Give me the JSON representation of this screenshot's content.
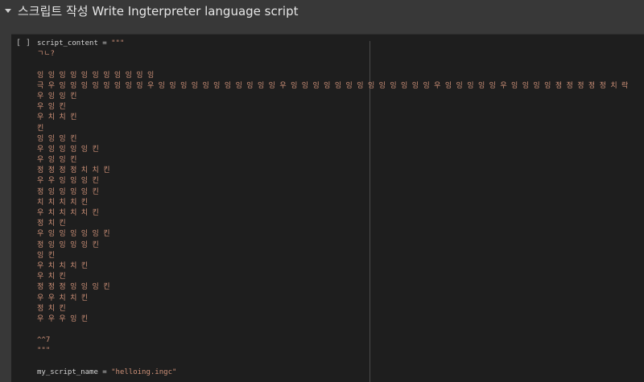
{
  "header": {
    "title": "스크립트 작성 Write Ingterpreter language script"
  },
  "cell": {
    "run_indicator": "[ ]",
    "assign1_lhs": "script_content = ",
    "assign1_open": "\"\"\"",
    "script_lines": [
      "ㄱㄴ?",
      "",
      "잉 잉 잉 잉 잉 잉 잉 잉 잉 잉 잉",
      "극 우 잉 잉 잉 잉 잉 잉 잉 잉 우 잉 잉 잉 잉 잉 잉 잉 잉 잉 잉 잉 우 잉 잉 잉 잉 잉 잉 잉 잉 잉 잉 잉 잉 잉 우 잉 잉 잉 잉 잉 우 잉 잉 잉 잉 정 정 정 정 정 치 락",
      "우 잉 잉 킨",
      "우 잉 킨",
      "우 치 치 킨",
      "킨",
      "잉 잉 잉 킨",
      "우 잉 잉 잉 잉 킨",
      "우 잉 잉 킨",
      "정 정 정 정 치 치 킨",
      "우 우 잉 잉 잉 킨",
      "정 잉 잉 잉 잉 킨",
      "치 치 치 치 킨",
      "우 치 치 치 치 킨",
      "정 치 킨",
      "우 잉 잉 잉 잉 잉 킨",
      "정 잉 잉 잉 잉 킨",
      "잉 킨",
      "우 치 치 치 킨",
      "우 치 킨",
      "정 정 정 잉 잉 잉 킨",
      "우 우 치 치 킨",
      "정 치 킨",
      "우 우 우 잉 킨",
      "",
      "^^7"
    ],
    "assign1_close": "\"\"\"",
    "assign2_lhs": "my_script_name = ",
    "assign2_value": "\"helloing.ingc\""
  }
}
